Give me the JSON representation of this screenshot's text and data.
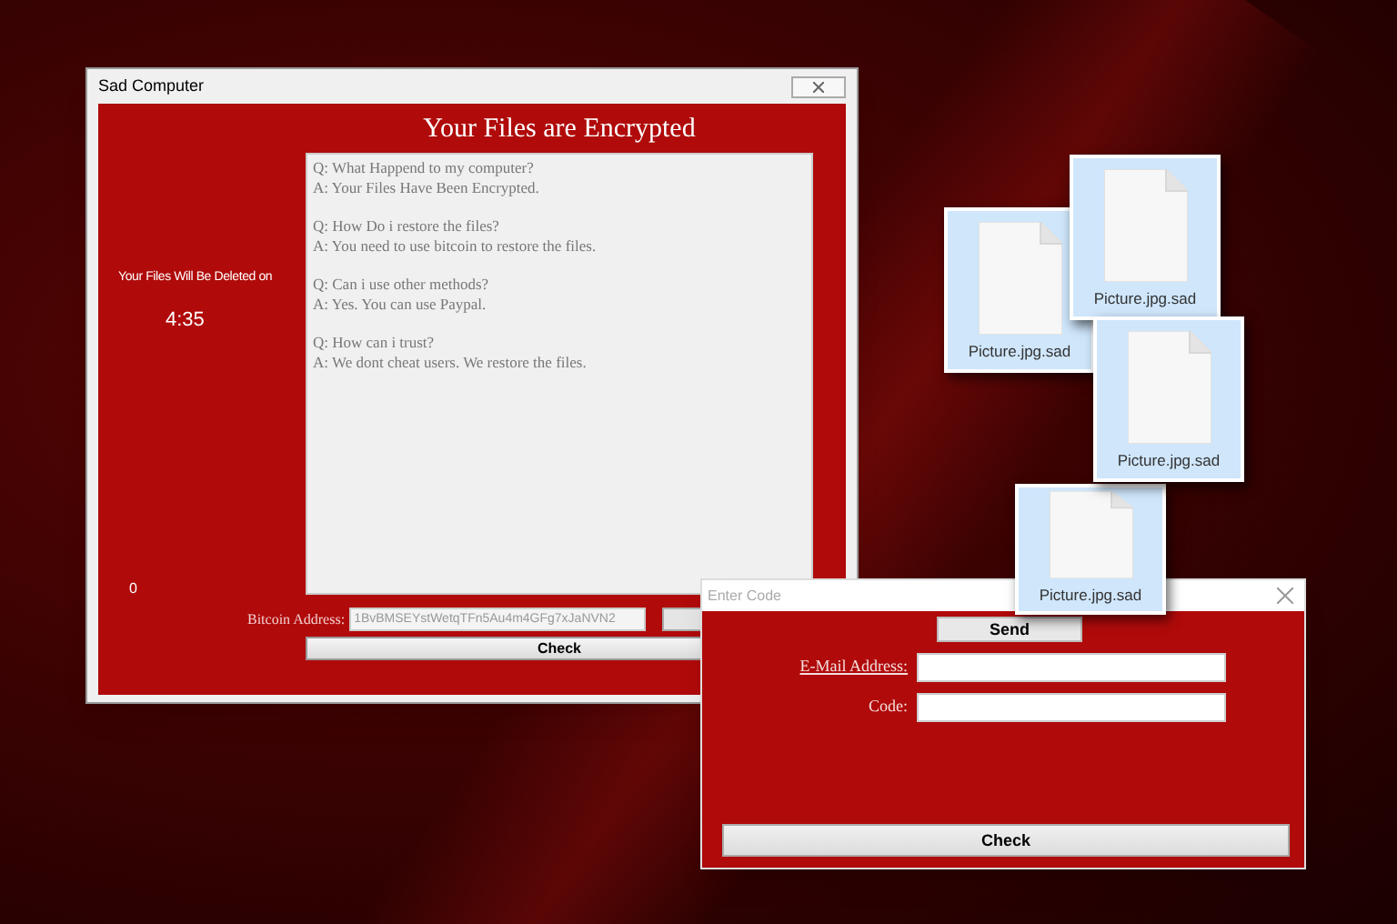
{
  "main_window": {
    "title": "Sad Computer",
    "heading": "Your Files are Encrypted",
    "deletion_label": "Your Files Will Be Deleted on",
    "timer": "4:35",
    "counter": "0",
    "faq": [
      {
        "q": "Q: What Happend to my computer?",
        "a": "A: Your Files Have Been Encrypted."
      },
      {
        "q": "Q: How Do i restore the files?",
        "a": "A: You need to use bitcoin to restore the files."
      },
      {
        "q": "Q: Can i use other methods?",
        "a": "A: Yes. You can use Paypal."
      },
      {
        "q": "Q: How can i trust?",
        "a": "A: We dont cheat users. We restore the files."
      }
    ],
    "bitcoin_label": "Bitcoin Address:",
    "bitcoin_address": "1BvBMSEYstWetqTFn5Au4m4GFg7xJaNVN2",
    "check_button": "Check"
  },
  "files": [
    {
      "name": "Picture.jpg.sad"
    },
    {
      "name": "Picture.jpg.sad"
    },
    {
      "name": "Picture.jpg.sad"
    },
    {
      "name": "Picture.jpg.sad"
    }
  ],
  "code_window": {
    "title": "Enter Code",
    "send_button": "Send",
    "email_label": "E-Mail Address:",
    "code_label": "Code:",
    "check_button": "Check"
  }
}
